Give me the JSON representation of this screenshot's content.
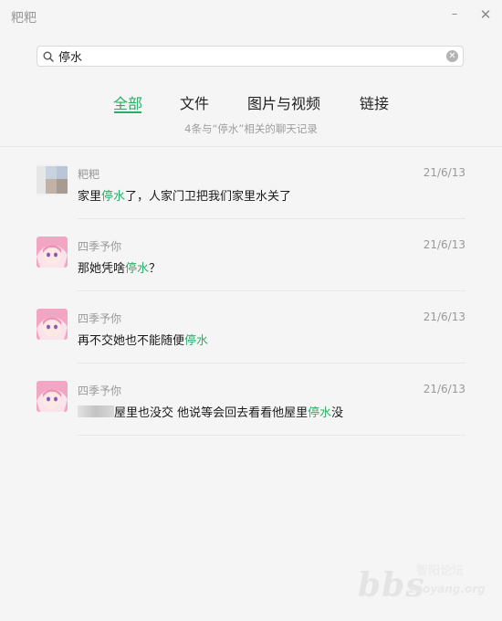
{
  "window": {
    "title": "粑粑",
    "minimize_glyph": "–",
    "close_glyph": "✕"
  },
  "search": {
    "query": "停水",
    "clear_glyph": "✕"
  },
  "tabs": [
    {
      "label": "全部",
      "active": true
    },
    {
      "label": "文件",
      "active": false
    },
    {
      "label": "图片与视频",
      "active": false
    },
    {
      "label": "链接",
      "active": false
    }
  ],
  "result_count": "4条与“停水”相关的聊天记录",
  "results": [
    {
      "sender": "粑粑",
      "date": "21/6/13",
      "parts": [
        "家里",
        "停水",
        "了，人家门卫把我们家里水关了"
      ]
    },
    {
      "sender": "四季予你",
      "date": "21/6/13",
      "parts": [
        "那她凭啥",
        "停水",
        "？"
      ]
    },
    {
      "sender": "四季予你",
      "date": "21/6/13",
      "parts": [
        "再不交她也不能随便",
        "停水",
        ""
      ]
    },
    {
      "sender": "四季予你",
      "date": "21/6/13",
      "parts": [
        "屋里也没交  他说等会回去看看他屋里",
        "停水",
        "没"
      ]
    }
  ],
  "watermark": {
    "big": "bbs",
    "top": "智阳论坛",
    "bottom": "zaoyang.org"
  },
  "colors": {
    "accent": "#2aae67",
    "background": "#f5f5f5",
    "muted_text": "#999999"
  },
  "icons": {
    "search": "search-icon",
    "clear": "clear-icon"
  }
}
